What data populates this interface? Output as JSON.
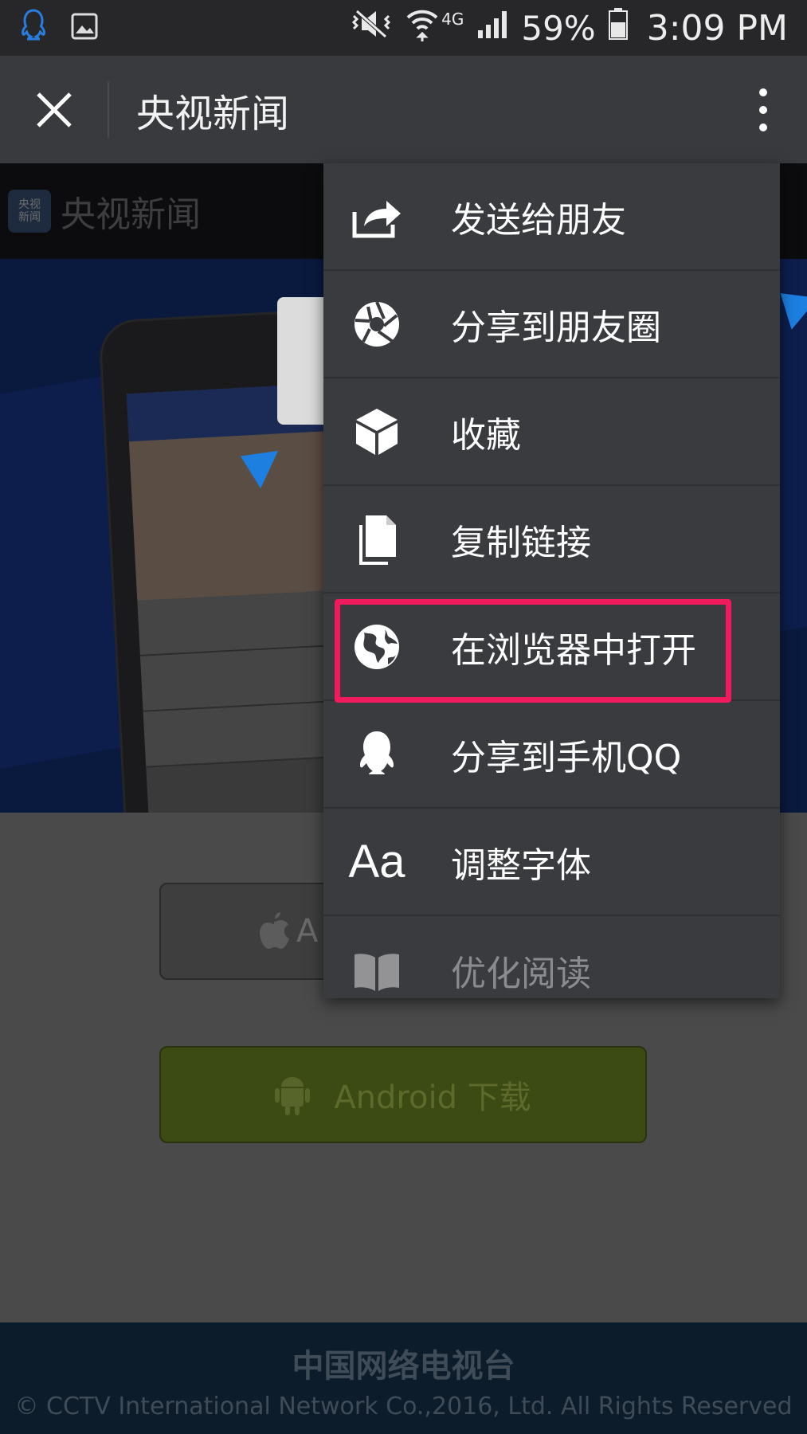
{
  "status_bar": {
    "battery_percent": "59%",
    "time": "3:09 PM",
    "network": "4G"
  },
  "title_bar": {
    "title": "央视新闻"
  },
  "web_page": {
    "logo_text": "央视新闻",
    "logo_badge": "央视\n新闻",
    "ios_button_label": "A",
    "android_button_label": "Android 下载",
    "footer_title": "中国网络电视台",
    "footer_copyright": "© CCTV International Network Co.,2016, Ltd. All Rights Reserved"
  },
  "menu": {
    "items": [
      {
        "label": "发送给朋友",
        "icon": "share-arrow-icon"
      },
      {
        "label": "分享到朋友圈",
        "icon": "moments-aperture-icon"
      },
      {
        "label": "收藏",
        "icon": "favorite-cube-icon"
      },
      {
        "label": "复制链接",
        "icon": "copy-link-icon"
      },
      {
        "label": "在浏览器中打开",
        "icon": "globe-icon",
        "highlighted": true
      },
      {
        "label": "分享到手机QQ",
        "icon": "qq-penguin-icon"
      },
      {
        "label": "调整字体",
        "icon": "font-size-icon",
        "icon_text": "Aa"
      },
      {
        "label": "优化阅读",
        "icon": "book-icon",
        "faded": true
      }
    ]
  },
  "colors": {
    "highlight": "#f01a5c",
    "menu_bg": "#3a3b3f",
    "titlebar_bg": "#393a3e",
    "accent_blue": "#1d7fe0"
  }
}
